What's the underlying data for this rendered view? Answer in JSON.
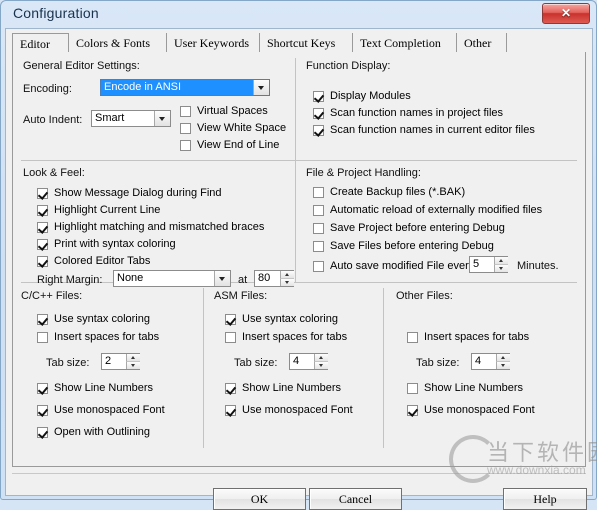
{
  "window": {
    "title": "Configuration",
    "close_label": "✕"
  },
  "tabs": [
    {
      "label": "Editor",
      "selected": true
    },
    {
      "label": "Colors & Fonts",
      "selected": false
    },
    {
      "label": "User Keywords",
      "selected": false
    },
    {
      "label": "Shortcut Keys",
      "selected": false
    },
    {
      "label": "Text Completion",
      "selected": false
    },
    {
      "label": "Other",
      "selected": false
    }
  ],
  "general_editor": {
    "group_label": "General Editor Settings:",
    "encoding_label": "Encoding:",
    "encoding_value": "Encode in ANSI",
    "auto_indent_label": "Auto Indent:",
    "auto_indent_value": "Smart",
    "checks": [
      {
        "label": "Virtual Spaces",
        "checked": false
      },
      {
        "label": "View White Space",
        "checked": false
      },
      {
        "label": "View End of Line",
        "checked": false
      }
    ]
  },
  "function_display": {
    "group_label": "Function Display:",
    "checks": [
      {
        "label": "Display Modules",
        "checked": true
      },
      {
        "label": "Scan function names in project files",
        "checked": true
      },
      {
        "label": "Scan function names in current editor files",
        "checked": true
      }
    ]
  },
  "look_feel": {
    "group_label": "Look & Feel:",
    "checks": [
      {
        "label": "Show Message Dialog during Find",
        "checked": true
      },
      {
        "label": "Highlight Current Line",
        "checked": true
      },
      {
        "label": "Highlight matching and mismatched braces",
        "checked": true
      },
      {
        "label": "Print with syntax coloring",
        "checked": true
      },
      {
        "label": "Colored Editor Tabs",
        "checked": true
      }
    ],
    "right_margin_label": "Right Margin:",
    "right_margin_value": "None",
    "at_label": "at",
    "at_value": "80"
  },
  "file_project": {
    "group_label": "File & Project Handling:",
    "checks": [
      {
        "label": "Create Backup files (*.BAK)",
        "checked": false
      },
      {
        "label": "Automatic reload of externally modified files",
        "checked": false
      },
      {
        "label": "Save Project before entering Debug",
        "checked": false
      },
      {
        "label": "Save Files before entering Debug",
        "checked": false
      },
      {
        "label": "Auto save modified File every",
        "checked": false
      }
    ],
    "autosave_value": "5",
    "minutes_label": "Minutes."
  },
  "cpp_files": {
    "group_label": "C/C++ Files:",
    "use_syntax_coloring": {
      "label": "Use syntax coloring",
      "checked": true
    },
    "insert_spaces": {
      "label": "Insert spaces for tabs",
      "checked": false
    },
    "tab_size_label": "Tab size:",
    "tab_size_value": "2",
    "show_line_numbers": {
      "label": "Show Line Numbers",
      "checked": true
    },
    "monospaced": {
      "label": "Use monospaced Font",
      "checked": true
    },
    "outlining": {
      "label": "Open with Outlining",
      "checked": true
    }
  },
  "asm_files": {
    "group_label": "ASM Files:",
    "use_syntax_coloring": {
      "label": "Use syntax coloring",
      "checked": true
    },
    "insert_spaces": {
      "label": "Insert spaces for tabs",
      "checked": false
    },
    "tab_size_label": "Tab size:",
    "tab_size_value": "4",
    "show_line_numbers": {
      "label": "Show Line Numbers",
      "checked": true
    },
    "monospaced": {
      "label": "Use monospaced Font",
      "checked": true
    }
  },
  "other_files": {
    "group_label": "Other Files:",
    "insert_spaces": {
      "label": "Insert spaces for tabs",
      "checked": false
    },
    "tab_size_label": "Tab size:",
    "tab_size_value": "4",
    "show_line_numbers": {
      "label": "Show Line Numbers",
      "checked": false
    },
    "monospaced": {
      "label": "Use monospaced Font",
      "checked": true
    }
  },
  "footer": {
    "ok_label": "OK",
    "cancel_label": "Cancel",
    "help_label": "Help"
  },
  "watermark": {
    "cn_text": "当下软件园",
    "url_text": "www.downxia.com"
  },
  "colors": {
    "accent": "#1e90ff",
    "titlebar": "#d9e7f7",
    "panel": "#f0f0f0",
    "close_red": "#c9322c"
  }
}
